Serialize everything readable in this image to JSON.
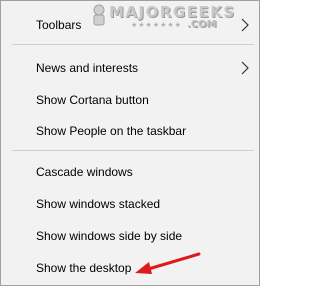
{
  "menu": {
    "items": [
      {
        "label": "Toolbars",
        "has_submenu": true
      },
      {
        "label": "News and interests",
        "has_submenu": true
      },
      {
        "label": "Show Cortana button",
        "has_submenu": false
      },
      {
        "label": "Show People on the taskbar",
        "has_submenu": false
      },
      {
        "label": "Cascade windows",
        "has_submenu": false
      },
      {
        "label": "Show windows stacked",
        "has_submenu": false
      },
      {
        "label": "Show windows side by side",
        "has_submenu": false
      },
      {
        "label": "Show the desktop",
        "has_submenu": false
      }
    ]
  },
  "watermark": {
    "brand": "MAJORGEEKS",
    "domain": ".COM",
    "stars": "★★★★★★★"
  },
  "icons": {
    "submenu": "chevron-right-icon",
    "annotation": "red-arrow-icon"
  },
  "colors": {
    "menu_background": "#f2f2f2",
    "separator": "#cfcfcf",
    "annotation_arrow": "#e0191b"
  }
}
